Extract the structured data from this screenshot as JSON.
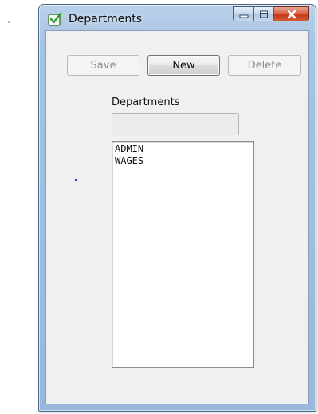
{
  "window": {
    "title": "Departments"
  },
  "toolbar": {
    "save_label": "Save",
    "new_label": "New",
    "delete_label": "Delete"
  },
  "form": {
    "departments_label": "Departments",
    "department_input_value": ""
  },
  "departments_list": {
    "items": [
      "ADMIN",
      "WAGES"
    ]
  },
  "icons": {
    "app": "checkmark-app-icon",
    "minimize": "minimize-icon",
    "maximize": "maximize-icon",
    "close": "close-icon"
  },
  "colors": {
    "titlebar": "#a7c3e2",
    "close_button": "#c4391a",
    "client_background": "#f0f0f0"
  }
}
